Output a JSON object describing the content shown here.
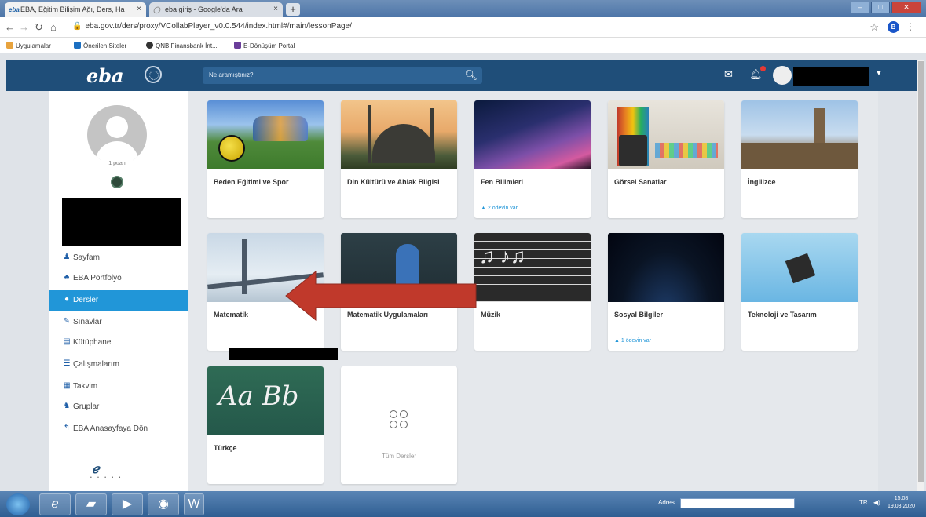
{
  "browser": {
    "tabs": [
      {
        "favicon": "eba",
        "title": "EBA, Eğitim Bilişim Ağı, Ders, Ha",
        "close": "×"
      },
      {
        "favicon": "google",
        "title": "eba giriş - Google'da Ara",
        "close": "×"
      }
    ],
    "new_tab": "+",
    "url": "eba.gov.tr/ders/proxy/VCollabPlayer_v0.0.544/index.html#/main/lessonPage/",
    "profile_initial": "B",
    "bookmarks": [
      "Uygulamalar",
      "Önerilen Siteler",
      "QNB Finansbank İnt...",
      "E-Dönüşüm Portal"
    ]
  },
  "header": {
    "logo": "eba",
    "search_placeholder": "Ne aramıştınız?"
  },
  "profile": {
    "points": "1 puan"
  },
  "sidebar": {
    "items": [
      {
        "label": "Sayfam",
        "icon": "user-icon",
        "glyph": "♟"
      },
      {
        "label": "EBA Portfolyo",
        "icon": "portfolio-icon",
        "glyph": "♣"
      },
      {
        "label": "Dersler",
        "icon": "lessons-icon",
        "glyph": "●"
      },
      {
        "label": "Sınavlar",
        "icon": "pencil-icon",
        "glyph": "✎"
      },
      {
        "label": "Kütüphane",
        "icon": "library-icon",
        "glyph": "▤"
      },
      {
        "label": "Çalışmalarım",
        "icon": "list-icon",
        "glyph": "☰"
      },
      {
        "label": "Takvim",
        "icon": "calendar-icon",
        "glyph": "▦"
      },
      {
        "label": "Gruplar",
        "icon": "groups-icon",
        "glyph": "♞"
      },
      {
        "label": "EBA Anasayfaya Dön",
        "icon": "back-arrow-icon",
        "glyph": "↰"
      }
    ],
    "active": "Dersler"
  },
  "courses": [
    {
      "title": "Beden Eğitimi ve Spor",
      "homework": ""
    },
    {
      "title": "Din Kültürü ve Ahlak Bilgisi",
      "homework": ""
    },
    {
      "title": "Fen Bilimleri",
      "homework": "2 ödevin var"
    },
    {
      "title": "Görsel Sanatlar",
      "homework": ""
    },
    {
      "title": "İngilizce",
      "homework": ""
    },
    {
      "title": "Matematik",
      "homework": ""
    },
    {
      "title": "Matematik Uygulamaları",
      "homework": ""
    },
    {
      "title": "Müzik",
      "homework": ""
    },
    {
      "title": "Sosyal Bilgiler",
      "homework": "1 ödevin var"
    },
    {
      "title": "Teknoloji ve Tasarım",
      "homework": ""
    },
    {
      "title": "Türkçe",
      "homework": ""
    }
  ],
  "all_lessons": "Tüm Dersler",
  "taskbar": {
    "address_label": "Adres",
    "lang": "TR",
    "time": "15:08",
    "date": "19.03.2020"
  },
  "colors": {
    "header": "#1f4e79",
    "active": "#2196d8",
    "arrow": "#c0392b"
  }
}
